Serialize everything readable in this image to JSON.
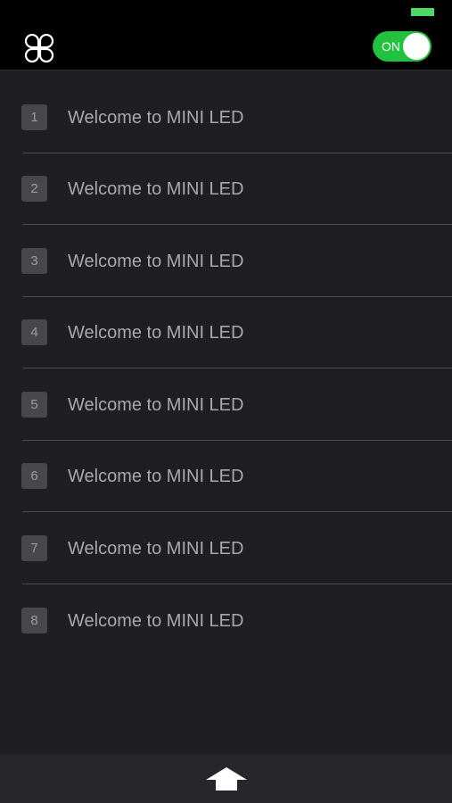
{
  "header": {
    "power_toggle_label": "ON",
    "power_toggle_state": "on"
  },
  "icons": {
    "app_icon": "clover-icon",
    "bottom_icon": "arrow-up-icon"
  },
  "colors": {
    "toggle_on": "#20c23e",
    "battery": "#4cd964",
    "list_background": "#1f1f23"
  },
  "list": {
    "items": [
      {
        "number": "1",
        "label": "Welcome to MINI LED"
      },
      {
        "number": "2",
        "label": "Welcome to MINI LED"
      },
      {
        "number": "3",
        "label": "Welcome to MINI LED"
      },
      {
        "number": "4",
        "label": "Welcome to MINI LED"
      },
      {
        "number": "5",
        "label": "Welcome to MINI LED"
      },
      {
        "number": "6",
        "label": "Welcome to MINI LED"
      },
      {
        "number": "7",
        "label": "Welcome to MINI LED"
      },
      {
        "number": "8",
        "label": "Welcome to MINI LED"
      }
    ]
  }
}
